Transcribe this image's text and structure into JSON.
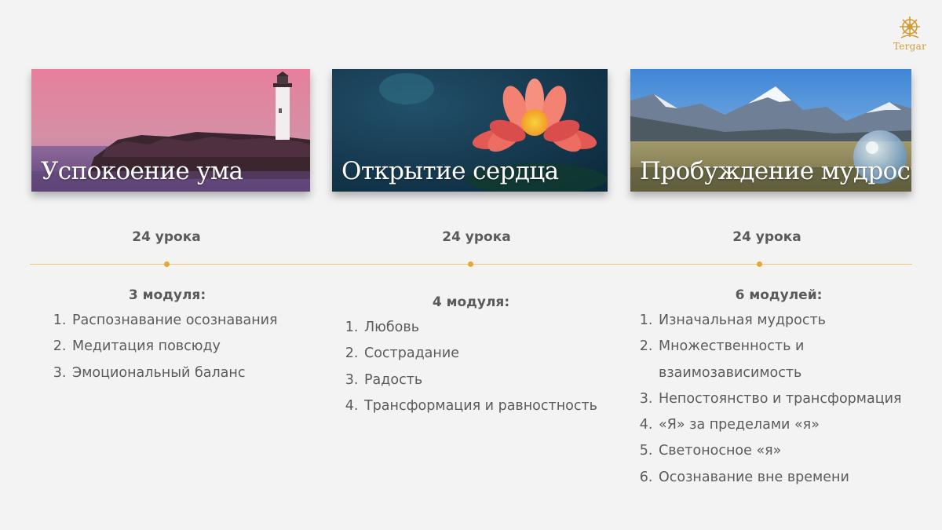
{
  "logo": {
    "text": "Tergar"
  },
  "courses": [
    {
      "title": "Успокоение ума",
      "lessons": "24 урока",
      "modules_heading": "3 модуля:",
      "modules": [
        "Распознавание осознавания",
        "Медитация повсюду",
        "Эмоциональный баланс"
      ]
    },
    {
      "title": "Открытие сердца",
      "lessons": "24 урока",
      "modules_heading": "4 модуля:",
      "modules": [
        "Любовь",
        "Сострадание",
        "Радость",
        "Трансформация и равностность"
      ]
    },
    {
      "title": "Пробуждение мудрости",
      "lessons": "24 урока",
      "modules_heading": "6 модулей:",
      "modules": [
        "Изначальная мудрость",
        "Множественность и взаимозависимость",
        "Непостоянство и трансформация",
        "«Я» за пределами «я»",
        "Светоносное «я»",
        "Осознавание вне времени"
      ]
    }
  ],
  "colors": {
    "accent": "#e3a936",
    "text": "#5a5a5a",
    "background": "#f3f3f3"
  }
}
